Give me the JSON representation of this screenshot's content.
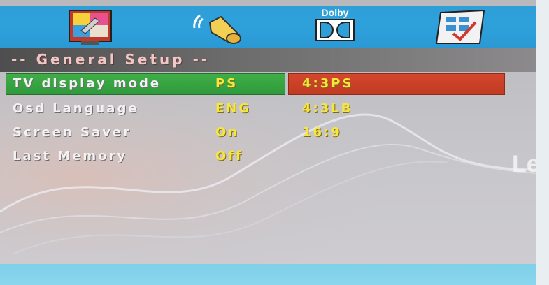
{
  "toolbar": {
    "icons": [
      {
        "name": "general-setup-icon"
      },
      {
        "name": "audio-setup-icon"
      },
      {
        "name": "dolby-setup-icon",
        "label": "Dolby"
      },
      {
        "name": "preference-setup-icon"
      }
    ]
  },
  "header": {
    "title": "-- General Setup --"
  },
  "menu": [
    {
      "label": "TV display mode",
      "value": "PS",
      "selected": true
    },
    {
      "label": "Osd Language",
      "value": "ENG"
    },
    {
      "label": "Screen Saver",
      "value": "On"
    },
    {
      "label": "Last Memory",
      "value": "Off"
    }
  ],
  "options": [
    "4:3PS",
    "4:3LB",
    "16:9"
  ],
  "selected_option": "4:3PS",
  "background": {
    "brand_text": "Le"
  },
  "colors": {
    "iconbar": "#2f9fd8",
    "selected_row": "#3fae47",
    "selected_option": "#d4472d",
    "value_text": "#f7e73a",
    "label_text": "#f4f1f4"
  }
}
